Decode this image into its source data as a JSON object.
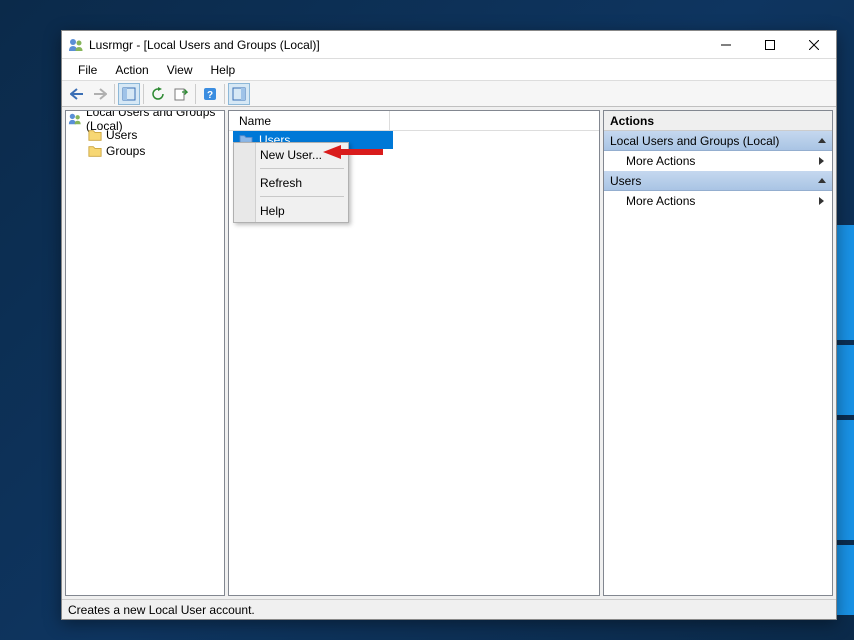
{
  "window": {
    "title": "Lusrmgr - [Local Users and Groups (Local)]"
  },
  "menubar": {
    "file": "File",
    "action": "Action",
    "view": "View",
    "help": "Help"
  },
  "tree": {
    "root": "Local Users and Groups (Local)",
    "users": "Users",
    "groups": "Groups"
  },
  "list": {
    "header_name": "Name",
    "item_users": "Users"
  },
  "context": {
    "new_user": "New User...",
    "refresh": "Refresh",
    "help": "Help"
  },
  "actions": {
    "panel_title": "Actions",
    "section1": "Local Users and Groups (Local)",
    "more1": "More Actions",
    "section2": "Users",
    "more2": "More Actions"
  },
  "status": "Creates a new Local User account."
}
